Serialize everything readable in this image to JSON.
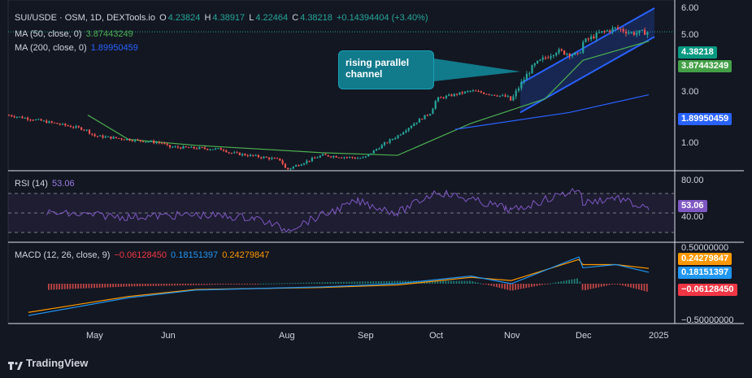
{
  "header": {
    "symbol": "SUI/USDE · OSM, 1D, DEXTools.io",
    "open_label": "O",
    "open": "4.23824",
    "high_label": "H",
    "high": "4.38917",
    "low_label": "L",
    "low": "4.22464",
    "close_label": "C",
    "close": "4.38218",
    "change": "+0.14394404 (+3.40%)"
  },
  "ma50": {
    "label": "MA (50, close, 0)",
    "value": "3.87443249",
    "color": "#4caf50"
  },
  "ma200": {
    "label": "MA (200, close, 0)",
    "value": "1.89950459",
    "color": "#2962ff"
  },
  "rsi": {
    "label": "RSI (14)",
    "value": "53.06",
    "color": "#7e57c2"
  },
  "macd": {
    "label": "MACD (12, 26, close, 9)",
    "hist": "−0.06128450",
    "macd_line": "0.18151397",
    "signal": "0.24279847"
  },
  "annotation": {
    "text_line1": "rising parallel",
    "text_line2": "channel"
  },
  "price_axis": {
    "ticks": [
      "6.00",
      "5.00",
      "3.00",
      "1.00"
    ],
    "badges": {
      "last": "4.38218",
      "ma50": "3.87443249",
      "ma200": "1.89950459"
    }
  },
  "rsi_axis": {
    "ticks": [
      "80.00",
      "40.00"
    ],
    "badge": "53.06"
  },
  "macd_axis": {
    "ticks": [
      "0.50000000",
      "−0.50000000"
    ],
    "badges": {
      "signal": "0.24279847",
      "macd": "0.18151397",
      "hist": "−0.06128450"
    }
  },
  "time_axis": {
    "labels": [
      "May",
      "Jun",
      "Aug",
      "Sep",
      "Oct",
      "Nov",
      "Dec",
      "2025"
    ]
  },
  "branding": {
    "text": "TradingView"
  },
  "colors": {
    "up": "#26a69a",
    "down": "#ef5350",
    "background": "#131722",
    "channel": "#2962ff"
  },
  "chart_data": {
    "type": "candlestick",
    "price_scale": "log",
    "ylim": [
      0.6,
      6.3
    ],
    "x_labels": [
      "May",
      "Jun",
      "Aug",
      "Sep",
      "Oct",
      "Nov",
      "Dec",
      "2025"
    ],
    "price_anchors": [
      [
        "Apr",
        1.45
      ],
      [
        "Apr",
        1.2
      ],
      [
        "May",
        1.1
      ],
      [
        "May",
        1.0
      ],
      [
        "Jun",
        0.95
      ],
      [
        "Jun",
        0.92
      ],
      [
        "Jul",
        0.88
      ],
      [
        "Jul",
        0.8
      ],
      [
        "Aug",
        0.7
      ],
      [
        "Aug",
        0.85
      ],
      [
        "Aug",
        0.82
      ],
      [
        "Sep",
        0.82
      ],
      [
        "Sep",
        1.1
      ],
      [
        "Sep",
        1.5
      ],
      [
        "Oct",
        1.8
      ],
      [
        "Oct",
        2.0
      ],
      [
        "Oct",
        1.85
      ],
      [
        "Nov",
        1.75
      ],
      [
        "Nov",
        2.8
      ],
      [
        "Nov",
        3.4
      ],
      [
        "Nov",
        3.2
      ],
      [
        "Dec",
        3.8
      ],
      [
        "Dec",
        4.3
      ],
      [
        "Dec",
        4.6
      ],
      [
        "Dec",
        4.3
      ],
      [
        "Dec",
        4.38
      ]
    ],
    "ma50_anchors": [
      [
        "Apr",
        1.45
      ],
      [
        "May",
        1.05
      ],
      [
        "Jun",
        0.97
      ],
      [
        "Aug",
        0.88
      ],
      [
        "Sep",
        0.85
      ],
      [
        "Oct",
        1.3
      ],
      [
        "Nov",
        1.8
      ],
      [
        "Dec",
        3.0
      ],
      [
        "Dec",
        3.87
      ]
    ],
    "ma200_anchors": [
      [
        "Nov",
        1.2
      ],
      [
        "Dec",
        1.5
      ],
      [
        "Dec",
        1.9
      ]
    ],
    "channel": {
      "upper": [
        [
          "Nov",
          2.2
        ],
        [
          "Dec",
          6.0
        ]
      ],
      "lower": [
        [
          "Nov",
          1.5
        ],
        [
          "Dec",
          4.1
        ]
      ]
    },
    "rsi_range": [
      25,
      90
    ],
    "rsi_levels": [
      70,
      50,
      30
    ],
    "rsi_anchors": [
      [
        "Apr",
        50
      ],
      [
        "May",
        46
      ],
      [
        "Jun",
        48
      ],
      [
        "Jul",
        45
      ],
      [
        "Aug",
        33
      ],
      [
        "Aug",
        62
      ],
      [
        "Sep",
        50
      ],
      [
        "Oct",
        72
      ],
      [
        "Oct",
        55
      ],
      [
        "Nov",
        52
      ],
      [
        "Nov",
        75
      ],
      [
        "Dec",
        60
      ],
      [
        "Dec",
        66
      ],
      [
        "Dec",
        53
      ]
    ],
    "macd_range": [
      -0.6,
      0.6
    ],
    "macd_anchors": [
      [
        "Apr",
        -0.5
      ],
      [
        "May",
        -0.22
      ],
      [
        "Jun",
        -0.1
      ],
      [
        "Aug",
        -0.05
      ],
      [
        "Sep",
        0.0
      ],
      [
        "Oct",
        0.12
      ],
      [
        "Nov",
        0.0
      ],
      [
        "Nov",
        0.42
      ],
      [
        "Dec",
        0.25
      ],
      [
        "Dec",
        0.3
      ],
      [
        "Dec",
        0.18
      ]
    ],
    "signal_anchors": [
      [
        "Apr",
        -0.45
      ],
      [
        "May",
        -0.2
      ],
      [
        "Jun",
        -0.09
      ],
      [
        "Aug",
        -0.06
      ],
      [
        "Sep",
        -0.02
      ],
      [
        "Oct",
        0.1
      ],
      [
        "Nov",
        0.05
      ],
      [
        "Nov",
        0.38
      ],
      [
        "Dec",
        0.3
      ],
      [
        "Dec",
        0.3
      ],
      [
        "Dec",
        0.24
      ]
    ]
  }
}
